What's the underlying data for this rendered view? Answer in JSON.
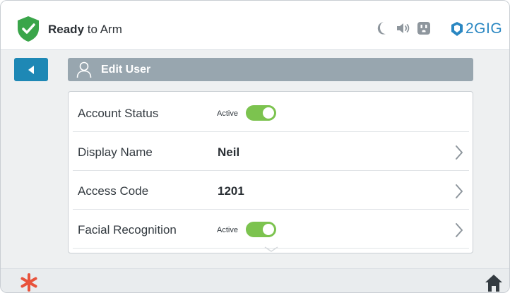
{
  "status": {
    "strong": "Ready",
    "rest": " to Arm",
    "shield_color": "#3aa54a"
  },
  "top_icons": [
    "moon-icon",
    "speaker-icon",
    "outlet-icon"
  ],
  "brand": {
    "name": "2GIG",
    "color": "#2a87c2"
  },
  "back_button": {
    "icon": "arrow-left-icon",
    "color": "#1e88b5"
  },
  "header": {
    "title": "Edit User",
    "icon": "user-icon"
  },
  "rows": [
    {
      "label": "Account Status",
      "state": "Active",
      "toggle_on": true
    },
    {
      "label": "Display Name",
      "value": "Neil",
      "has_chevron": true
    },
    {
      "label": "Access Code",
      "value": "1201",
      "has_chevron": true
    },
    {
      "label": "Facial Recognition",
      "state": "Active",
      "toggle_on": true,
      "has_chevron": true
    }
  ],
  "bottom": {
    "left_icon": "asterisk-icon",
    "left_color": "#e8533c",
    "right_icon": "home-icon"
  },
  "colors": {
    "accent": "#1e88b5",
    "toggle_on": "#7cc34f",
    "header_bg": "#98a6af"
  }
}
